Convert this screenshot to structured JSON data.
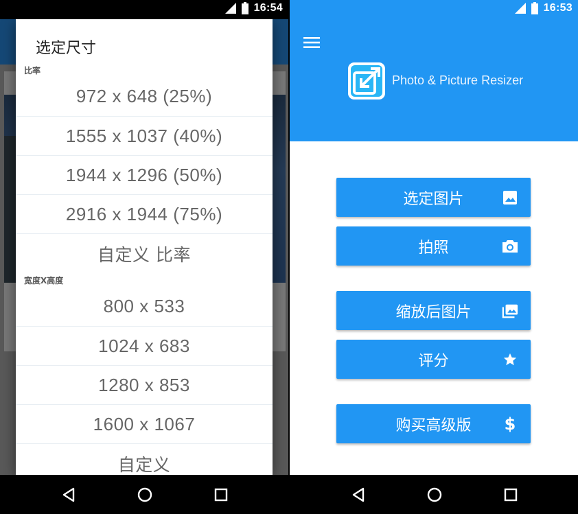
{
  "left": {
    "status": {
      "time": "16:54"
    },
    "dialog": {
      "title": "选定尺寸",
      "section_ratio": "比率",
      "ratio_options": [
        "972 x 648  (25%)",
        "1555 x 1037  (40%)",
        "1944 x 1296  (50%)",
        "2916 x 1944  (75%)",
        "自定义 比率"
      ],
      "section_size": "宽度X高度",
      "size_options": [
        "800 x 533",
        "1024 x 683",
        "1280 x 853",
        "1600 x 1067",
        "自定义"
      ]
    }
  },
  "right": {
    "status": {
      "time": "16:53"
    },
    "app_title": "Photo & Picture Resizer",
    "buttons": {
      "select_picture": "选定图片",
      "take_photo": "拍照",
      "resized_pictures": "缩放后图片",
      "rate": "评分",
      "buy_premium": "购买高级版"
    }
  },
  "icons": {
    "signal": "signal-icon",
    "battery": "battery-icon",
    "menu": "hamburger-menu-icon",
    "logo": "resize-logo-icon",
    "image": "image-icon",
    "camera": "camera-icon",
    "gallery": "photo-library-icon",
    "star": "star-icon",
    "dollar": "dollar-icon",
    "back": "back-triangle-icon",
    "home": "home-circle-icon",
    "recents": "recents-square-icon"
  },
  "colors": {
    "primary": "#2196f3",
    "primary_dark_dim": "#154876",
    "text_option": "#666666"
  }
}
